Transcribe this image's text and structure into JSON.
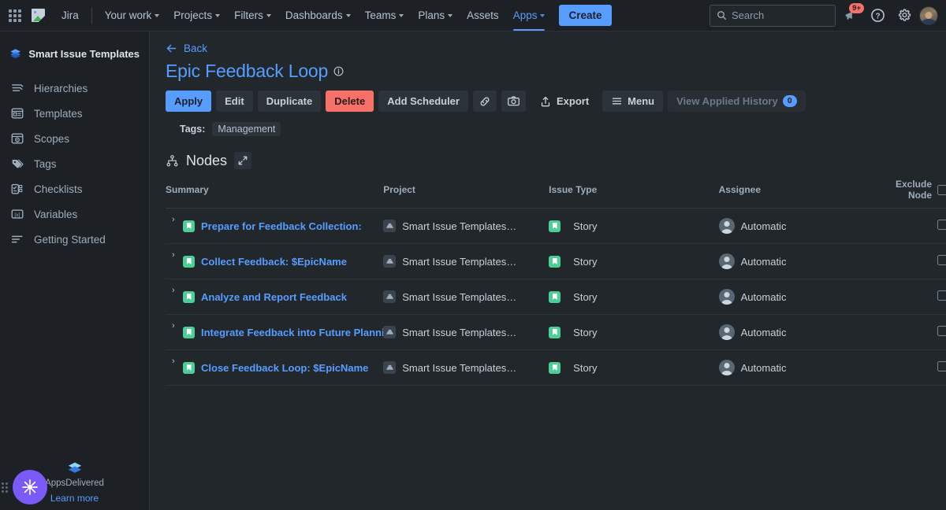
{
  "topnav": {
    "app_switcher_icon": "grid-apps-icon",
    "logo_icon": "jira-broken-image-icon",
    "product_name": "Jira",
    "items": [
      {
        "label": "Your work",
        "has_caret": true,
        "active": false
      },
      {
        "label": "Projects",
        "has_caret": true,
        "active": false
      },
      {
        "label": "Filters",
        "has_caret": true,
        "active": false
      },
      {
        "label": "Dashboards",
        "has_caret": true,
        "active": false
      },
      {
        "label": "Teams",
        "has_caret": true,
        "active": false
      },
      {
        "label": "Plans",
        "has_caret": true,
        "active": false
      },
      {
        "label": "Assets",
        "has_caret": false,
        "active": false
      },
      {
        "label": "Apps",
        "has_caret": true,
        "active": true
      }
    ],
    "create_label": "Create",
    "search_placeholder": "Search",
    "search_value": "",
    "notification_count": "9+",
    "notification_icon": "megaphone-icon",
    "help_icon": "help-circle-icon",
    "settings_icon": "gear-icon",
    "avatar_icon": "user-avatar",
    "accent_color": "#579dff",
    "badge_color": "#f87168"
  },
  "sidebar": {
    "app_title": "Smart Issue Templates",
    "app_logo_icon": "layers-icon",
    "items": [
      {
        "label": "Hierarchies",
        "icon": "hierarchy-icon"
      },
      {
        "label": "Templates",
        "icon": "template-icon"
      },
      {
        "label": "Scopes",
        "icon": "scope-icon"
      },
      {
        "label": "Tags",
        "icon": "tags-icon"
      },
      {
        "label": "Checklists",
        "icon": "checklist-icon"
      },
      {
        "label": "Variables",
        "icon": "variables-icon"
      },
      {
        "label": "Getting Started",
        "icon": "getting-started-icon"
      }
    ],
    "widget": {
      "logo_icon": "appsdelivered-layers-icon",
      "name": "AppsDelivered",
      "learn_more": "Learn more",
      "fab_icon": "sparkle-icon",
      "fab_color": "#7a5af8"
    }
  },
  "main": {
    "back_label": "Back",
    "back_icon": "arrow-left-icon",
    "page_title": "Epic Feedback Loop",
    "info_icon": "info-circle-icon",
    "toolbar": {
      "apply": "Apply",
      "edit": "Edit",
      "duplicate": "Duplicate",
      "delete": "Delete",
      "add_scheduler": "Add Scheduler",
      "link_icon": "link-icon",
      "camera_icon": "camera-icon",
      "export": "Export",
      "export_icon": "share-upload-icon",
      "menu": "Menu",
      "menu_icon": "hamburger-icon",
      "view_applied_history": "View Applied History",
      "view_applied_history_count": "0"
    },
    "tags_label": "Tags:",
    "tags": [
      "Management"
    ],
    "nodes": {
      "title": "Nodes",
      "icon": "sitemap-icon",
      "expand_icon": "expand-arrows-icon"
    },
    "table": {
      "columns": [
        "Summary",
        "Project",
        "Issue Type",
        "Assignee",
        "Exclude Node"
      ],
      "header_checkbox_checked": false,
      "rows": [
        {
          "chevron": "›",
          "type_icon": "story-icon",
          "summary": "Prepare for Feedback Collection:",
          "project_icon": "project-icon",
          "project": "Smart Issue Templates…",
          "issue_type": "Story",
          "assignee": "Automatic",
          "assignee_icon": "user-avatar-icon",
          "exclude": false
        },
        {
          "chevron": "›",
          "type_icon": "story-icon",
          "summary": "Collect Feedback: $EpicName",
          "project_icon": "project-icon",
          "project": "Smart Issue Templates…",
          "issue_type": "Story",
          "assignee": "Automatic",
          "assignee_icon": "user-avatar-icon",
          "exclude": false
        },
        {
          "chevron": "›",
          "type_icon": "story-icon",
          "summary": "Analyze and Report Feedback",
          "project_icon": "project-icon",
          "project": "Smart Issue Templates…",
          "issue_type": "Story",
          "assignee": "Automatic",
          "assignee_icon": "user-avatar-icon",
          "exclude": false
        },
        {
          "chevron": "›",
          "type_icon": "story-icon",
          "summary": "Integrate Feedback into Future Planning",
          "project_icon": "project-icon",
          "project": "Smart Issue Templates…",
          "issue_type": "Story",
          "assignee": "Automatic",
          "assignee_icon": "user-avatar-icon",
          "exclude": false
        },
        {
          "chevron": "›",
          "type_icon": "story-icon",
          "summary": "Close Feedback Loop: $EpicName",
          "project_icon": "project-icon",
          "project": "Smart Issue Templates…",
          "issue_type": "Story",
          "assignee": "Automatic",
          "assignee_icon": "user-avatar-icon",
          "exclude": false
        }
      ]
    }
  }
}
